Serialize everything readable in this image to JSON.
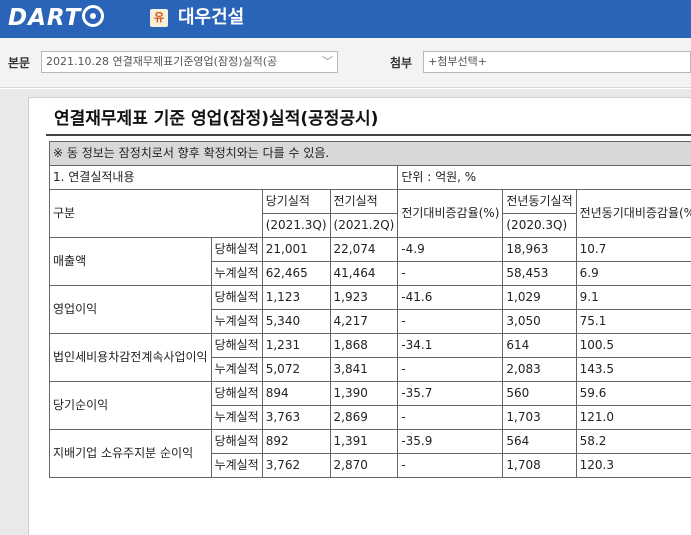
{
  "header": {
    "logo_text": "DART",
    "corp_badge": "유",
    "corp_name": "대우건설"
  },
  "toolbar": {
    "report_label": "본문",
    "report_value": "2021.10.28 연결재무제표기준영업(잠정)실적(공",
    "attach_label": "첨부",
    "attach_value": "+첨부선택+"
  },
  "document": {
    "title": "연결재무제표 기준 영업(잠정)실적(공정공시)",
    "notice": "※ 동 정보는 잠정치로서 향후 확정치와는 다를 수 있음.",
    "section": "1. 연결실적내용",
    "unit": "단위 : 억원, %",
    "headers": {
      "category": "구분",
      "current": "당기실적",
      "current_period": "(2021.3Q)",
      "previous": "전기실적",
      "previous_period": "(2021.2Q)",
      "qoq": "전기대비증감율(%)",
      "yoy_label": "전년동기실적",
      "yoy_period": "(2020.3Q)",
      "yoy_rate": "전년동기대비증감율(%)"
    },
    "rows": [
      {
        "item": "매출액",
        "sub": "당해실적",
        "cur": "21,001",
        "prev": "22,074",
        "qoq": "-4.9",
        "yoy": "18,963",
        "yoy_rate": "10.7"
      },
      {
        "item": "",
        "sub": "누계실적",
        "cur": "62,465",
        "prev": "41,464",
        "qoq": "-",
        "yoy": "58,453",
        "yoy_rate": "6.9"
      },
      {
        "item": "영업이익",
        "sub": "당해실적",
        "cur": "1,123",
        "prev": "1,923",
        "qoq": "-41.6",
        "yoy": "1,029",
        "yoy_rate": "9.1"
      },
      {
        "item": "",
        "sub": "누계실적",
        "cur": "5,340",
        "prev": "4,217",
        "qoq": "-",
        "yoy": "3,050",
        "yoy_rate": "75.1"
      },
      {
        "item": "법인세비용차감전계속사업이익",
        "sub": "당해실적",
        "cur": "1,231",
        "prev": "1,868",
        "qoq": "-34.1",
        "yoy": "614",
        "yoy_rate": "100.5"
      },
      {
        "item": "",
        "sub": "누계실적",
        "cur": "5,072",
        "prev": "3,841",
        "qoq": "-",
        "yoy": "2,083",
        "yoy_rate": "143.5"
      },
      {
        "item": "당기순이익",
        "sub": "당해실적",
        "cur": "894",
        "prev": "1,390",
        "qoq": "-35.7",
        "yoy": "560",
        "yoy_rate": "59.6"
      },
      {
        "item": "",
        "sub": "누계실적",
        "cur": "3,763",
        "prev": "2,869",
        "qoq": "-",
        "yoy": "1,703",
        "yoy_rate": "121.0"
      },
      {
        "item": "지배기업 소유주지분 순이익",
        "sub": "당해실적",
        "cur": "892",
        "prev": "1,391",
        "qoq": "-35.9",
        "yoy": "564",
        "yoy_rate": "58.2"
      },
      {
        "item": "",
        "sub": "누계실적",
        "cur": "3,762",
        "prev": "2,870",
        "qoq": "-",
        "yoy": "1,708",
        "yoy_rate": "120.3"
      }
    ]
  }
}
